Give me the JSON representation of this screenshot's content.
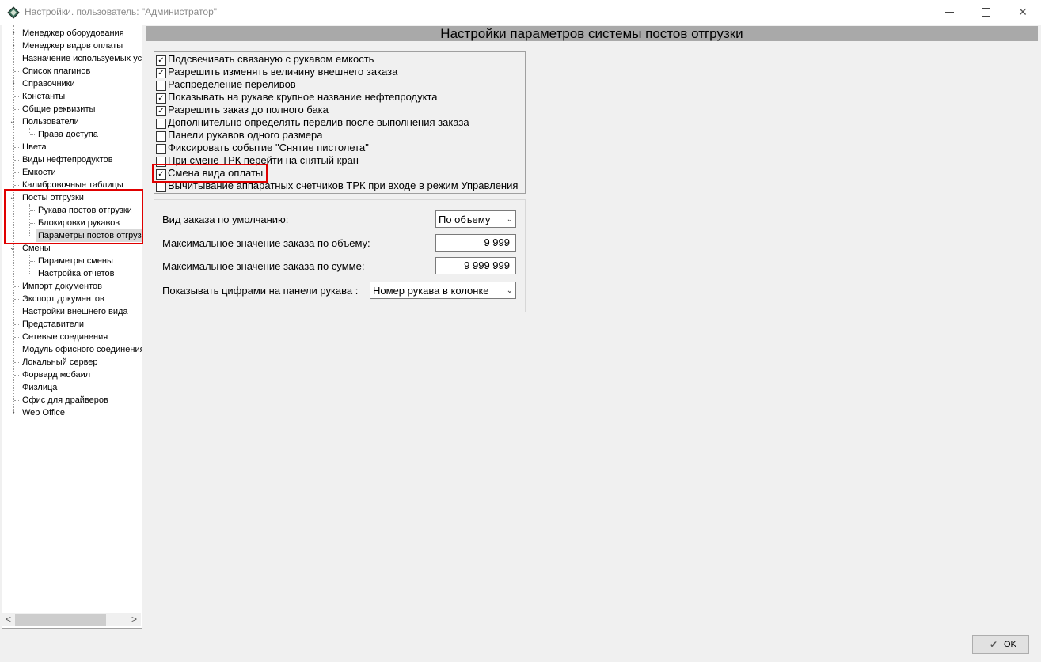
{
  "window": {
    "title": "Настройки. пользователь: \"Администратор\"",
    "minimize": "—",
    "maximize": "☐",
    "close": "✕"
  },
  "tree": {
    "items": [
      {
        "label": "Менеджер оборудования"
      },
      {
        "label": "Менеджер видов оплаты"
      },
      {
        "label": "Назначение используемых уст"
      },
      {
        "label": "Список плагинов"
      },
      {
        "label": "Справочники"
      },
      {
        "label": "Константы"
      },
      {
        "label": "Общие реквизиты"
      },
      {
        "label": "Пользователи"
      },
      {
        "label": "Права доступа"
      },
      {
        "label": "Цвета"
      },
      {
        "label": "Виды нефтепродуктов"
      },
      {
        "label": "Емкости"
      },
      {
        "label": "Калибровочные таблицы"
      },
      {
        "label": "Посты отгрузки"
      },
      {
        "label": "Рукава постов отгрузки"
      },
      {
        "label": "Блокировки рукавов"
      },
      {
        "label": "Параметры постов отгруз"
      },
      {
        "label": "Смены"
      },
      {
        "label": "Параметры смены"
      },
      {
        "label": "Настройка отчетов"
      },
      {
        "label": "Импорт документов"
      },
      {
        "label": "Экспорт документов"
      },
      {
        "label": "Настройки внешнего вида"
      },
      {
        "label": "Представители"
      },
      {
        "label": "Сетевые соединения"
      },
      {
        "label": "Модуль офисного соединения"
      },
      {
        "label": "Локальный сервер"
      },
      {
        "label": "Форвард мобаил"
      },
      {
        "label": "Физлица"
      },
      {
        "label": "Офис для драйверов"
      },
      {
        "label": "Web Office"
      }
    ],
    "scroll_left": "<",
    "scroll_right": ">"
  },
  "main": {
    "title": "Настройки параметров системы постов отгрузки",
    "options": [
      {
        "label": "Подсвечивать связаную с рукавом емкость",
        "checked": true
      },
      {
        "label": "Разрешить изменять величину внешнего заказа",
        "checked": true
      },
      {
        "label": "Распределение переливов",
        "checked": false
      },
      {
        "label": "Показывать на рукаве крупное название нефтепродукта",
        "checked": true
      },
      {
        "label": "Разрешить заказ до полного бака",
        "checked": true
      },
      {
        "label": "Дополнительно определять перелив после выполнения заказа",
        "checked": false
      },
      {
        "label": "Панели рукавов одного размера",
        "checked": false
      },
      {
        "label": "Фиксировать событие \"Снятие пистолета\"",
        "checked": false
      },
      {
        "label": "При смене ТРК перейти на снятый кран",
        "checked": false
      },
      {
        "label": "Смена вида оплаты",
        "checked": true
      },
      {
        "label": "Вычитывание аппаратных счетчиков ТРК при входе в режим Управления",
        "checked": false
      }
    ],
    "order_type": {
      "label": "Вид заказа по умолчанию:",
      "value": "По объему"
    },
    "max_volume": {
      "label": "Максимальное значение заказа по объему:",
      "value": "9 999"
    },
    "max_sum": {
      "label": "Максимальное значение заказа по сумме:",
      "value": "9 999 999"
    },
    "panel_digits": {
      "label": "Показывать цифрами на панели рукава :",
      "value": "Номер рукава в колонке"
    }
  },
  "footer": {
    "ok_label": "OK"
  },
  "colors": {
    "highlight": "#e00000",
    "header_bg": "#a9a9a9"
  }
}
